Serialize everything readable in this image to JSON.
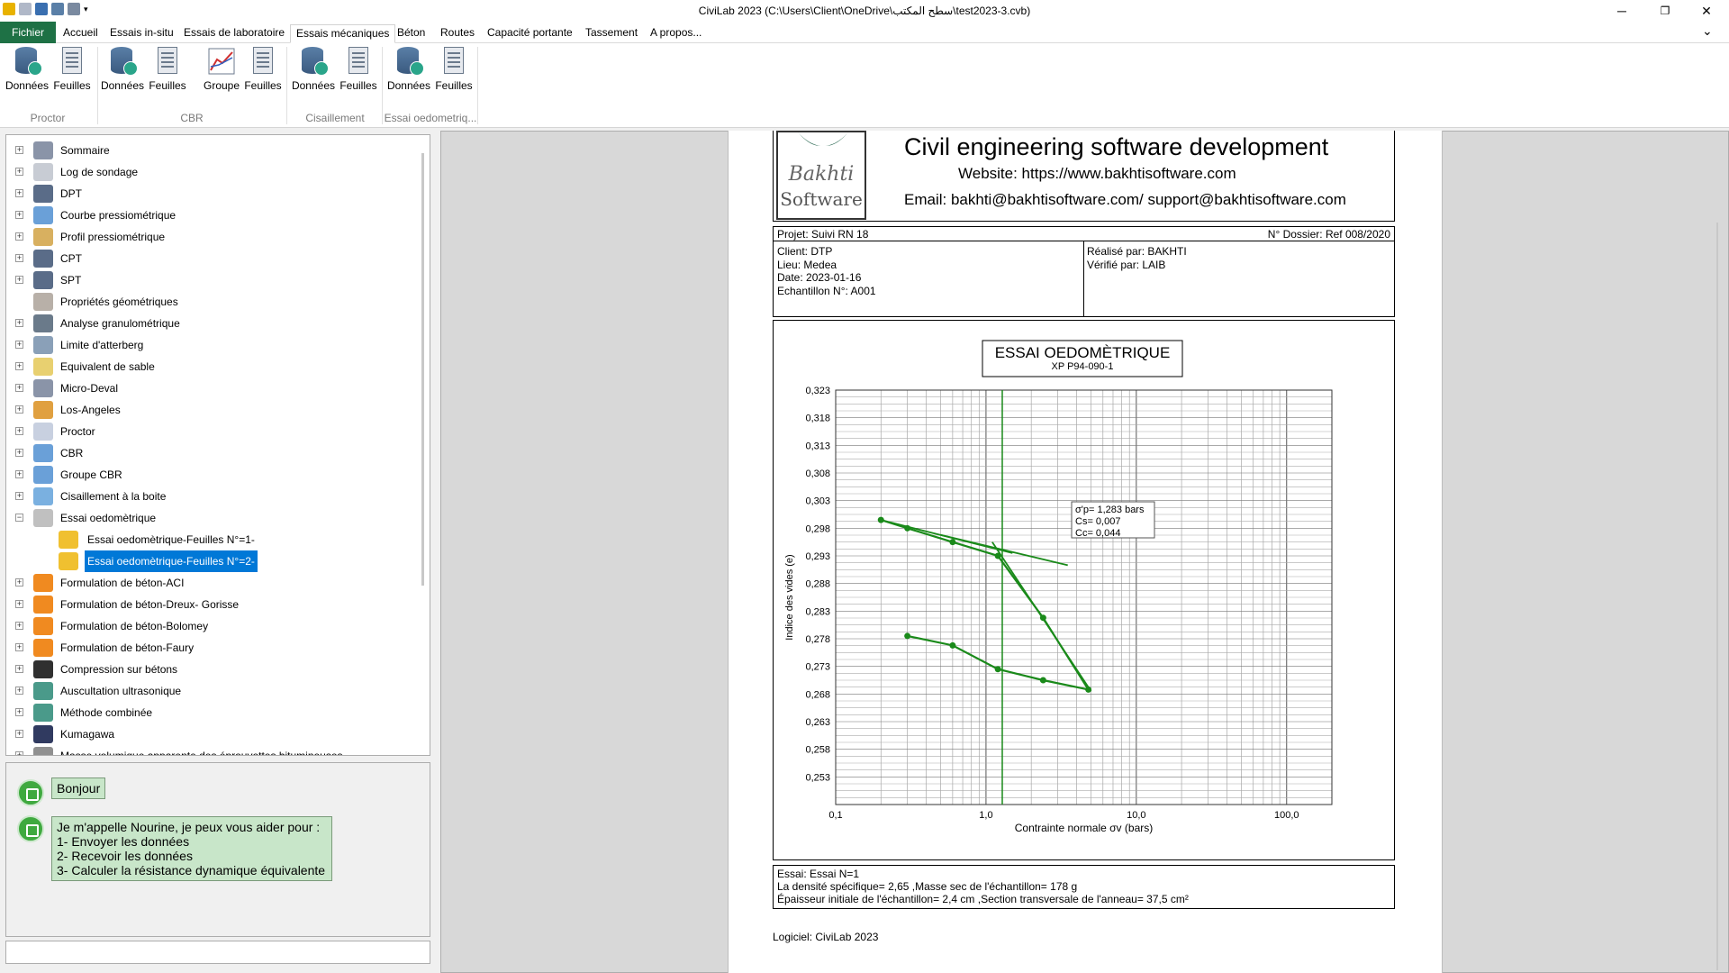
{
  "window": {
    "title": "CiviLab  2023 (C:\\Users\\Client\\OneDrive\\سطح المكتب\\test2023-3.cvb)",
    "minimize": "─",
    "maximize": "❐",
    "close": "✕"
  },
  "menu": {
    "file": "Fichier",
    "tabs": [
      "Accueil",
      "Essais in-situ",
      "Essais de laboratoire",
      "Essais mécaniques",
      "Béton",
      "Routes",
      "Capacité portante",
      "Tassement",
      "A propos..."
    ],
    "active_tab": "Essais mécaniques",
    "collapse_icon": "chevron-up-icon"
  },
  "ribbon": {
    "buttons": [
      "Données",
      "Feuilles",
      "Données",
      "Feuilles",
      "Groupe",
      "Feuilles",
      "Données",
      "Feuilles",
      "Données",
      "Feuilles"
    ],
    "groups": [
      "Proctor",
      "CBR",
      "Cisaillement",
      "Essai oedometriq..."
    ]
  },
  "tree": {
    "items": [
      "Sommaire",
      "Log de sondage",
      "DPT",
      "Courbe pressiométrique",
      "Profil pressiométrique",
      "CPT",
      "SPT",
      "Propriétés géométriques",
      "Analyse granulométrique",
      "Limite d'atterberg",
      "Equivalent de sable",
      "Micro-Deval",
      "Los-Angeles",
      "Proctor",
      "CBR",
      "Groupe CBR",
      "Cisaillement à la boite",
      "Essai oedomètrique",
      "Essai oedomètrique-Feuilles N°=1-",
      "Essai oedomètrique-Feuilles N°=2-",
      "Formulation de béton-ACI",
      "Formulation de béton-Dreux- Gorisse",
      "Formulation de béton-Bolomey",
      "Formulation de béton-Faury",
      "Compression sur bétons",
      "Auscultation ultrasonique",
      "Méthode combinée",
      "Kumagawa",
      "Masse volumique apparente des éprouvettes bitumineuses"
    ]
  },
  "chat": {
    "greeting": "Bonjour",
    "lines": [
      "Je m'appelle Nourine, je peux vous aider pour :",
      "1- Envoyer les données",
      "2- Recevoir les données",
      "3- Calculer la résistance dynamique équivalente"
    ],
    "input_value": ""
  },
  "document": {
    "logo_line1": "Bakhti",
    "logo_line2": "Software",
    "header_title": "Civil engineering software development",
    "website": "Website: https://www.bakhtisoftware.com",
    "email": "Email: bakhti@bakhtisoftware.com/ support@bakhtisoftware.com",
    "project": "Projet: Suivi RN 18",
    "dossier": "N° Dossier: Ref 008/2020",
    "client": "Client: DTP",
    "lieu": "Lieu: Medea",
    "date": "Date: 2023-01-16",
    "echantillon": "Echantillon N°: A001",
    "realise": "Réalisé par: BAKHTI",
    "verifie": "Vérifié par: LAIB",
    "essai": "Essai: Essai N=1",
    "densite": "La densité spécifique= 2,65 ,Masse sec de l'échantillon= 178 g",
    "epaisseur": "Épaisseur initiale de l'échantillon= 2,4 cm ,Section transversale de l'anneau= 37,5 cm²",
    "logiciel": "Logiciel: CiviLab 2023"
  },
  "chart_data": {
    "type": "line",
    "title": "ESSAI OEDOMÈTRIQUE",
    "subtitle": "XP P94-090-1",
    "xlabel": "Contrainte normale σv (bars)",
    "ylabel": "Indice des vides (e)",
    "x_scale": "log",
    "xlim": [
      0.1,
      200
    ],
    "ylim": [
      0.248,
      0.323
    ],
    "x_ticks": [
      0.1,
      1.0,
      10.0,
      100.0
    ],
    "x_tick_labels": [
      "0,1",
      "1,0",
      "10,0",
      "100,0"
    ],
    "y_ticks": [
      0.323,
      0.318,
      0.313,
      0.308,
      0.303,
      0.298,
      0.293,
      0.288,
      0.283,
      0.278,
      0.273,
      0.268,
      0.263,
      0.258,
      0.253
    ],
    "y_tick_labels": [
      "0,323",
      "0,318",
      "0,313",
      "0,308",
      "0,303",
      "0,298",
      "0,293",
      "0,288",
      "0,283",
      "0,278",
      "0,273",
      "0,268",
      "0,263",
      "0,258",
      "0,253"
    ],
    "grid": true,
    "color": "#1a8a1a",
    "series": [
      {
        "x": [
          0.2,
          0.3,
          0.6,
          1.2,
          2.4,
          4.8,
          2.4,
          1.2,
          0.6,
          0.3
        ],
        "y": [
          0.2995,
          0.298,
          0.2955,
          0.293,
          0.2818,
          0.2688,
          0.2705,
          0.2725,
          0.2768,
          0.2785
        ]
      }
    ],
    "tangents": [
      {
        "x": [
          0.2,
          1.5
        ],
        "y": [
          0.2995,
          0.2935
        ]
      },
      {
        "x": [
          0.5,
          3.5
        ],
        "y": [
          0.2968,
          0.2913
        ]
      },
      {
        "x": [
          1.1,
          5.0
        ],
        "y": [
          0.2955,
          0.2685
        ]
      }
    ],
    "vline_x": 1.283,
    "annotation": [
      "σ'p= 1,283 bars",
      "Cs= 0,007",
      "Cc= 0,044"
    ]
  }
}
